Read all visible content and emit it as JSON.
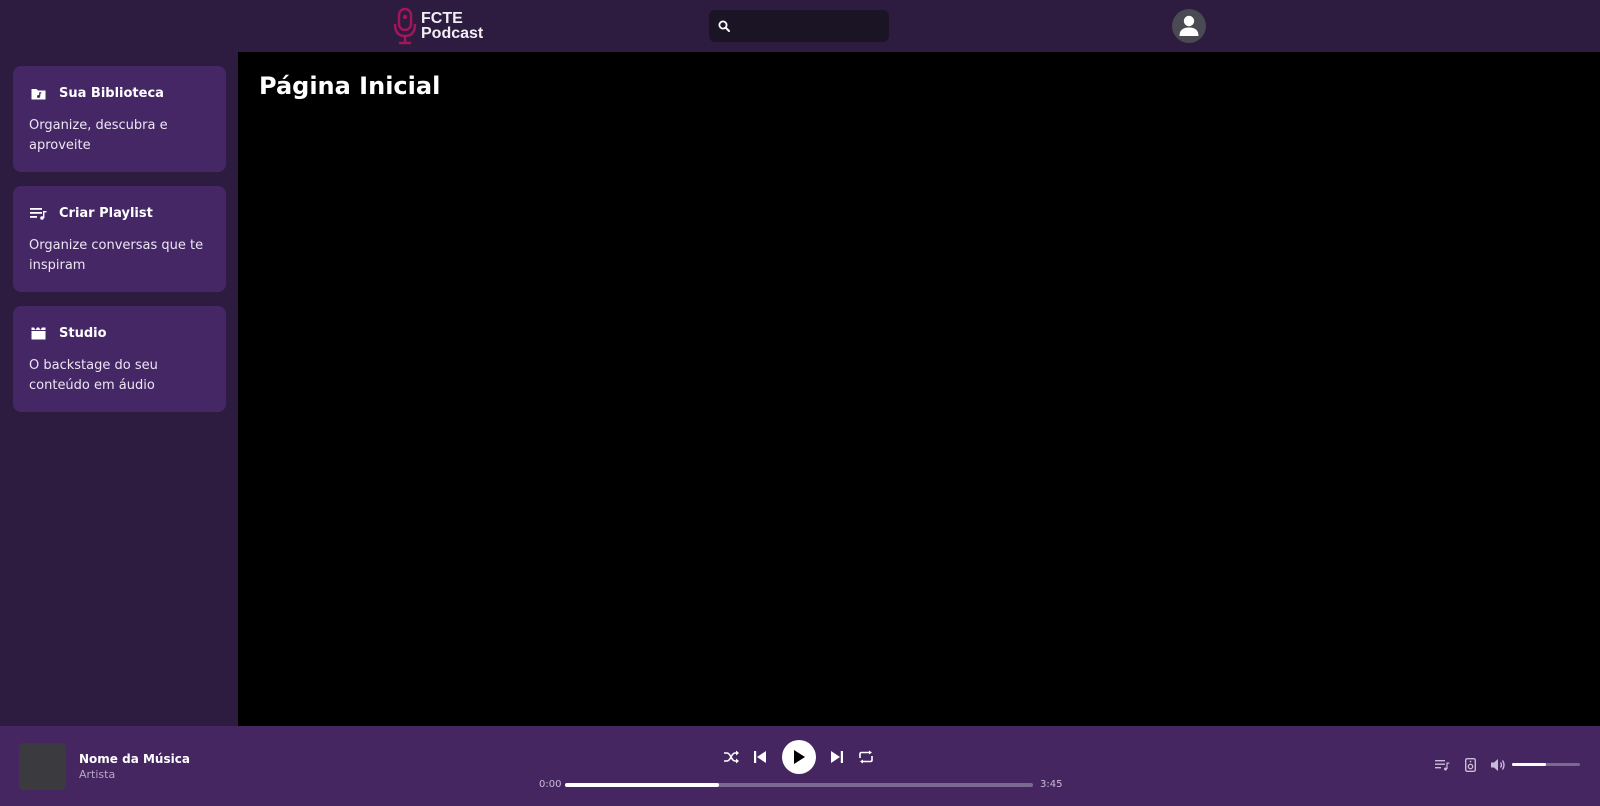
{
  "header": {
    "logo": {
      "line1": "FCTE",
      "line2": "Podcast"
    },
    "search": {
      "placeholder": "",
      "value": ""
    },
    "icons": {
      "search": "search-icon",
      "avatar": "user-icon"
    }
  },
  "sidebar": {
    "items": [
      {
        "icon": "library-icon",
        "title": "Sua Biblioteca",
        "description": "Organize, descubra e aproveite"
      },
      {
        "icon": "playlist-add-icon",
        "title": "Criar Playlist",
        "description": "Organize conversas que te inspiram"
      },
      {
        "icon": "clapperboard-icon",
        "title": "Studio",
        "description": "O backstage do seu conteúdo em áudio"
      }
    ]
  },
  "main": {
    "title": "Página Inicial"
  },
  "player": {
    "track": {
      "title": "Nome da Música",
      "artist": "Artista"
    },
    "current_time": "0:00",
    "total_time": "3:45",
    "progress": 0.33,
    "volume": 0.5,
    "controls": [
      "shuffle-icon",
      "previous-icon",
      "play-icon",
      "next-icon",
      "repeat-icon"
    ],
    "extras": [
      "queue-icon",
      "device-icon",
      "volume-icon"
    ]
  },
  "colors": {
    "header_bg": "#2e1b40",
    "sidebar_card": "#462766",
    "player_bg": "#452661",
    "logo_accent": "#a3165a"
  }
}
